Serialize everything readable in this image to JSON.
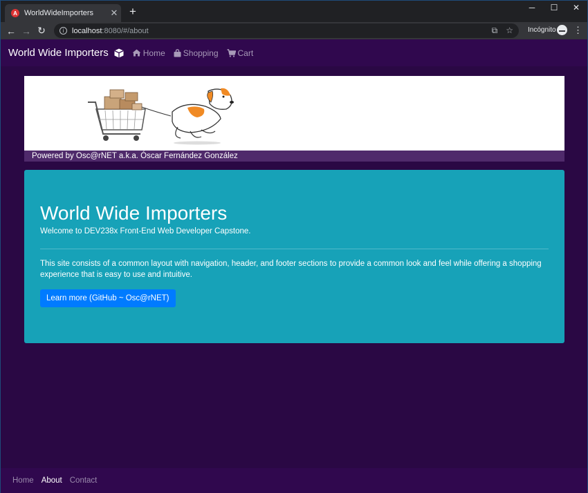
{
  "browser": {
    "tab_title": "WorldWideImporters",
    "favicon_letter": "A",
    "url_host": "localhost",
    "url_rest": ":8080/#/about",
    "incognito_label": "Incógnito"
  },
  "navbar": {
    "brand": "World Wide Importers",
    "links": [
      {
        "label": "Home",
        "icon": "home-icon"
      },
      {
        "label": "Shopping",
        "icon": "shopping-bag-icon"
      },
      {
        "label": "Cart",
        "icon": "cart-icon"
      }
    ]
  },
  "banner": {
    "powered_by": "Powered by Osc@rNET a.k.a. Óscar Fernández González"
  },
  "jumbotron": {
    "title": "World Wide Importers",
    "lead": "Welcome to DEV238x Front-End Web Developer Capstone.",
    "description": "This site consists of a common layout with navigation, header, and footer sections to provide a common look and feel while offering a shopping experience that is easy to use and intuitive.",
    "button_label": "Learn more (GitHub ~ Osc@rNET)"
  },
  "footer": {
    "links": [
      {
        "label": "Home",
        "active": false
      },
      {
        "label": "About",
        "active": true
      },
      {
        "label": "Contact",
        "active": false
      }
    ]
  },
  "colors": {
    "page_bg": "#2a0844",
    "navbar_bg": "#30084e",
    "jumbotron_bg": "#17a2b8",
    "button_bg": "#007bff",
    "powered_bar_bg": "#4f2a6b"
  }
}
